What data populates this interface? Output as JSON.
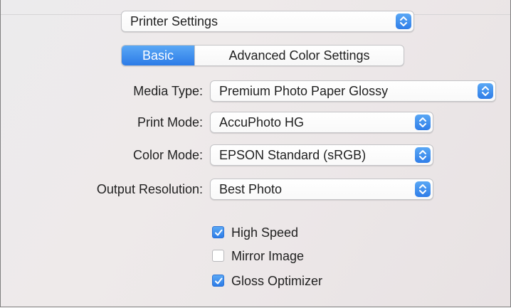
{
  "dialog": {
    "section_popup": {
      "value": "Printer Settings"
    },
    "tabs": [
      {
        "label": "Basic",
        "selected": true
      },
      {
        "label": "Advanced Color Settings",
        "selected": false
      }
    ],
    "fields": {
      "media_type": {
        "label": "Media Type:",
        "value": "Premium Photo Paper Glossy"
      },
      "print_mode": {
        "label": "Print Mode:",
        "value": "AccuPhoto HG"
      },
      "color_mode": {
        "label": "Color Mode:",
        "value": "EPSON Standard (sRGB)"
      },
      "output_resolution": {
        "label": "Output Resolution:",
        "value": "Best Photo"
      }
    },
    "checkboxes": [
      {
        "label": "High Speed",
        "checked": true
      },
      {
        "label": "Mirror Image",
        "checked": false
      },
      {
        "label": "Gloss Optimizer",
        "checked": true
      }
    ]
  },
  "colors": {
    "accent": "#2f7de8",
    "background": "#ece9ea",
    "text": "#1f1f1f"
  },
  "icons": {
    "popup_stepper": "up-down-chevron-icon",
    "checkbox_checked": "checkmark-icon"
  }
}
